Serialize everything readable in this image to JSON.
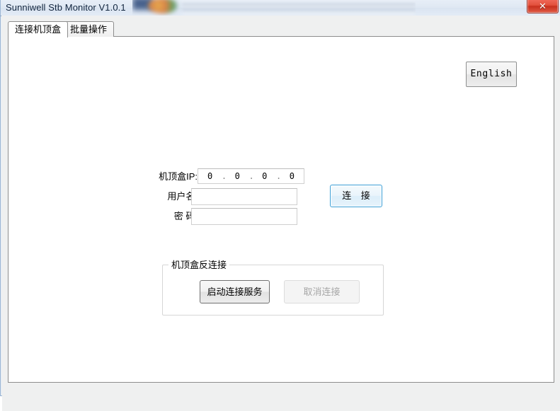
{
  "window": {
    "title": "Sunniwell Stb Monitor V1.0.1",
    "close_label": "✕",
    "close_icon": "close-icon"
  },
  "tabs": [
    {
      "label": "连接机顶盒",
      "active": true
    },
    {
      "label": "批量操作",
      "active": false
    }
  ],
  "toolbar": {
    "language_button": "English"
  },
  "form": {
    "ip_label": "机顶盒IP:",
    "username_label": "用户名:",
    "password_label": "密 码:",
    "ip_value": {
      "o1": "0",
      "o2": "0",
      "o3": "0",
      "o4": "0",
      "sep": "."
    },
    "username_value": "",
    "password_value": "",
    "username_placeholder": "",
    "password_placeholder": "",
    "connect_button": "连 接"
  },
  "groupbox": {
    "title": "机顶盒反连接",
    "start_button": "启动连接服务",
    "cancel_button": "取消连接",
    "cancel_disabled": true
  },
  "colors": {
    "titlebar_text": "#10243d",
    "close_red": "#c8301e",
    "connect_accent": "#3c9fd6",
    "panel_bg": "#ffffff",
    "client_bg": "#eff0f0",
    "disabled_text": "#a6a6a6"
  }
}
